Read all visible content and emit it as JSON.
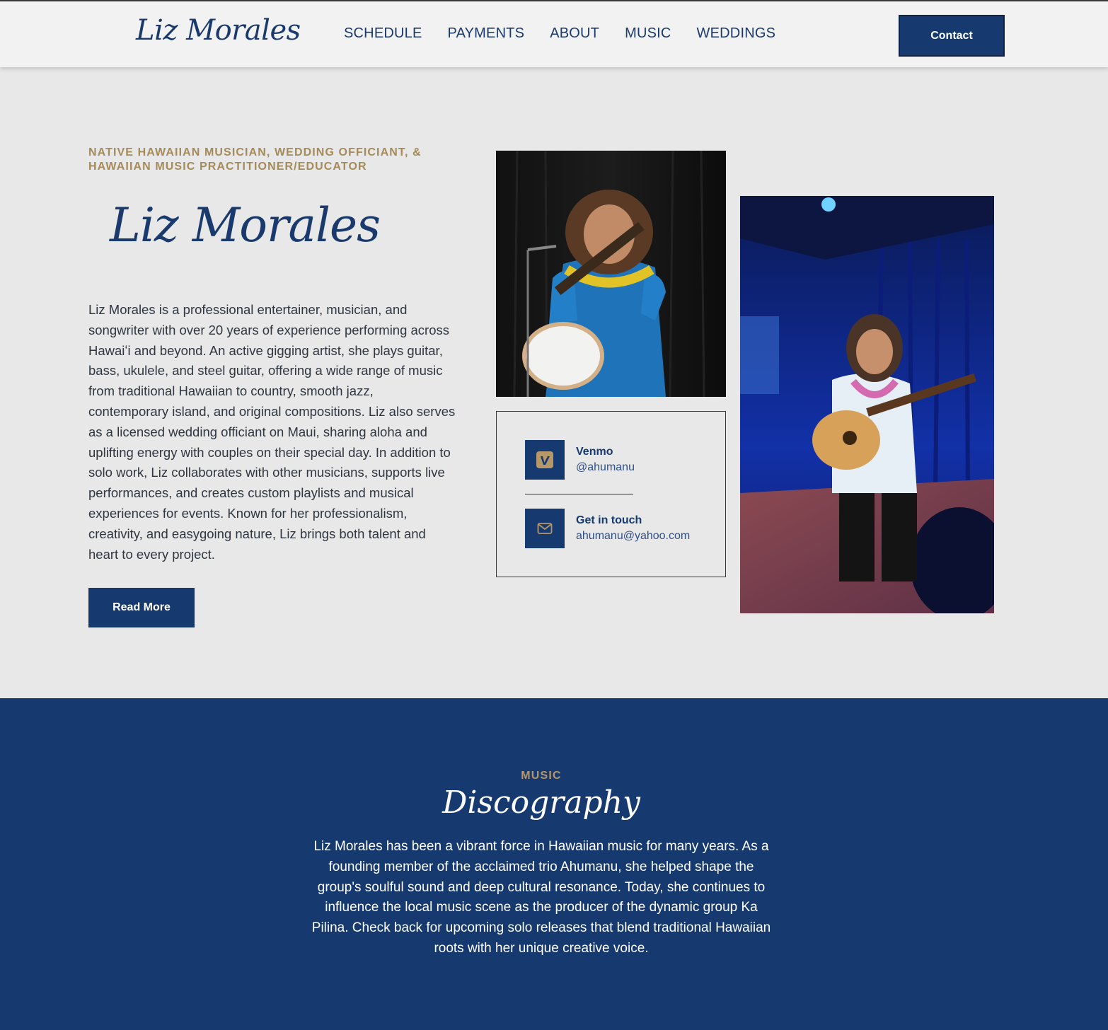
{
  "header": {
    "logo": "Liz Morales",
    "nav": [
      "SCHEDULE",
      "PAYMENTS",
      "ABOUT",
      "MUSIC",
      "WEDDINGS"
    ],
    "contact_label": "Contact"
  },
  "hero": {
    "eyebrow": "NATIVE HAWAIIAN MUSICIAN, WEDDING OFFICIANT, & HAWAIIAN MUSIC PRACTITIONER/EDUCATOR",
    "title": "Liz Morales",
    "bio": "Liz Morales is a professional entertainer, musician, and songwriter with over 20 years of experience performing across Hawaiʻi and beyond. An active gigging artist, she plays guitar, bass, ukulele, and steel guitar, offering a wide range of music from traditional Hawaiian to country, smooth jazz, contemporary island, and original compositions. Liz also serves as a licensed wedding officiant on Maui, sharing aloha and uplifting energy with couples on their special day. In addition to solo work, Liz collaborates with other musicians, supports live performances, and creates custom playlists and musical experiences for events. Known for her professionalism, creativity, and easygoing nature, Liz brings both talent and heart to every project.",
    "read_more": "Read More"
  },
  "contact_card": {
    "venmo_label": "Venmo",
    "venmo_handle": "@ahumanu",
    "email_label": "Get in touch",
    "email": "ahumanu@yahoo.com"
  },
  "music": {
    "eyebrow": "MUSIC",
    "title": "Discography",
    "text": "Liz Morales has been a vibrant force in Hawaiian music for many years. As a founding member of the acclaimed trio Ahumanu, she helped shape the group's soulful sound and deep cultural resonance. Today, she continues to influence the local music scene as the producer of the dynamic group Ka Pilina. Check back for upcoming solo releases that blend traditional Hawaiian roots with her unique creative voice."
  },
  "colors": {
    "navy": "#16396f",
    "gold": "#a58a5a",
    "background": "#e8e8e8"
  },
  "icons": {
    "venmo": "venmo-icon",
    "email": "mail-icon"
  }
}
